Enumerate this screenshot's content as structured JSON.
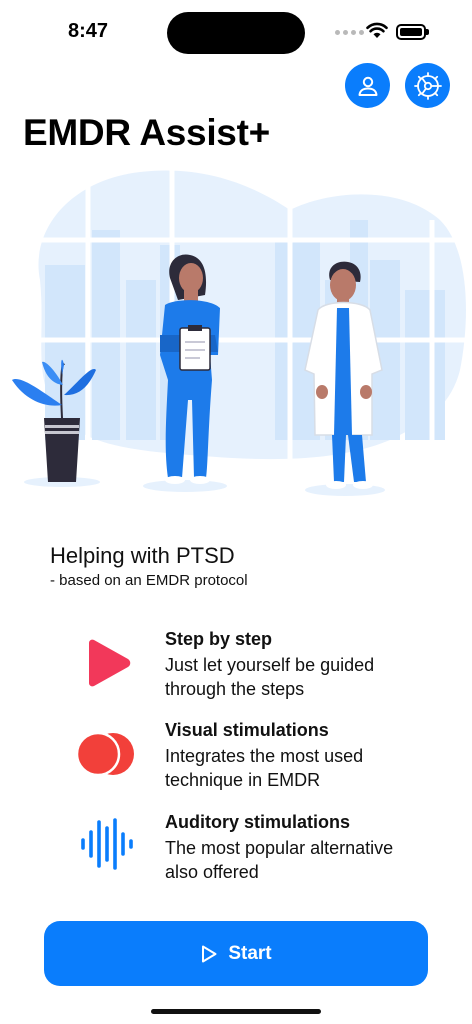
{
  "status_bar": {
    "time": "8:47"
  },
  "header": {
    "title": "EMDR Assist+",
    "profile_icon": "person-icon",
    "settings_icon": "gear-icon",
    "accent_color": "#0a7dfc"
  },
  "intro": {
    "heading": "Helping with PTSD",
    "subheading": "- based on an EMDR protocol"
  },
  "features": [
    {
      "icon": "play-triangle-icon",
      "title": "Step by step",
      "description": "Just let yourself be guided through the steps",
      "color": "#f2385a"
    },
    {
      "icon": "overlapping-circles-icon",
      "title": "Visual stimulations",
      "description": "Integrates the most used technique in EMDR",
      "color": "#f2403a"
    },
    {
      "icon": "waveform-icon",
      "title": "Auditory stimulations",
      "description": "The most popular alternative also offered",
      "color": "#0a7dfc"
    }
  ],
  "start_button": {
    "label": "Start",
    "icon": "play-outline-icon"
  }
}
